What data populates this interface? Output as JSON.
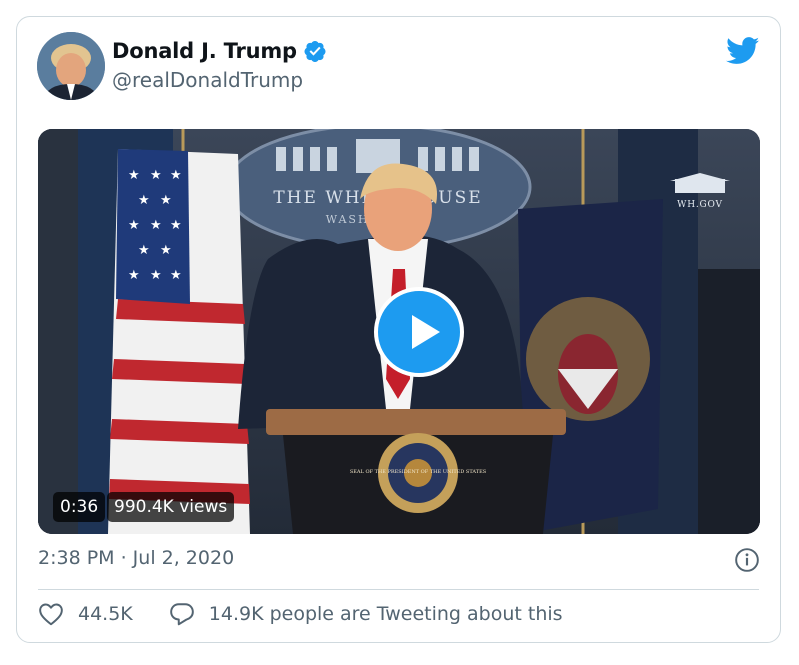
{
  "author": {
    "display_name": "Donald J. Trump",
    "handle": "@realDonaldTrump",
    "verified": true,
    "avatar_icon": "profile-photo"
  },
  "brand_icon": "twitter-bird-icon",
  "video": {
    "duration": "0:36",
    "views": "990.4K views",
    "watermark": "WH.GOV",
    "backdrop_text": "THE WHITE HOUSE",
    "backdrop_subtext": "WASHINGTON",
    "seal_text": "SEAL OF THE PRESIDENT OF THE UNITED STATES"
  },
  "timestamp": "2:38 PM · Jul 2, 2020",
  "engagement": {
    "likes": "44.5K",
    "conversation": "14.9K people are Tweeting about this"
  },
  "colors": {
    "accent": "#1d9bf0",
    "secondary_text": "#536471",
    "primary_text": "#0f1419",
    "border": "#cfd9de"
  }
}
